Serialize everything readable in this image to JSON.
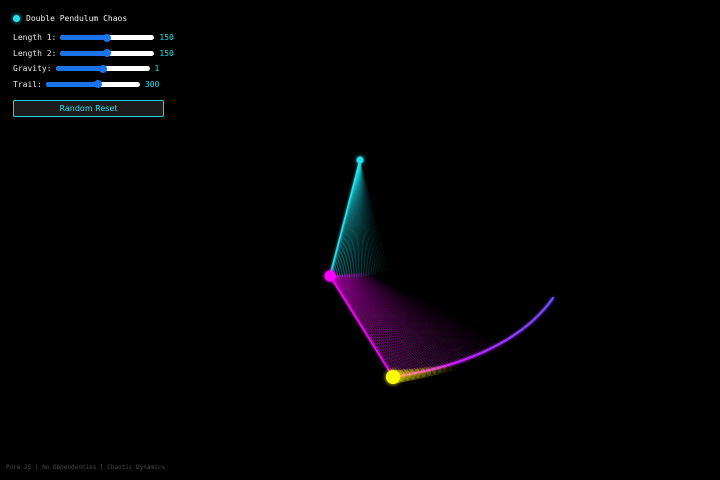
{
  "panel": {
    "title": "Double Pendulum Chaos",
    "sliders": [
      {
        "label": "Length 1:",
        "value": "150",
        "fraction": 0.5
      },
      {
        "label": "Length 2:",
        "value": "150",
        "fraction": 0.5
      },
      {
        "label": "Gravity:",
        "value": "1",
        "fraction": 0.5
      },
      {
        "label": "Trail:",
        "value": "300",
        "fraction": 0.55
      }
    ],
    "reset_label": "Random Reset"
  },
  "footer": {
    "text": "Pure JS | No Dependencies | Chaotic Dynamics"
  },
  "colors": {
    "accent": "#22e3ee",
    "slider": "#1a73e8",
    "arm1": "#22e3ee",
    "arm2": "#ff00ff",
    "bob2": "#ffff00",
    "trail_end": "#6a4cff",
    "background": "#000000"
  },
  "icons": {
    "status": "status-dot-icon"
  }
}
